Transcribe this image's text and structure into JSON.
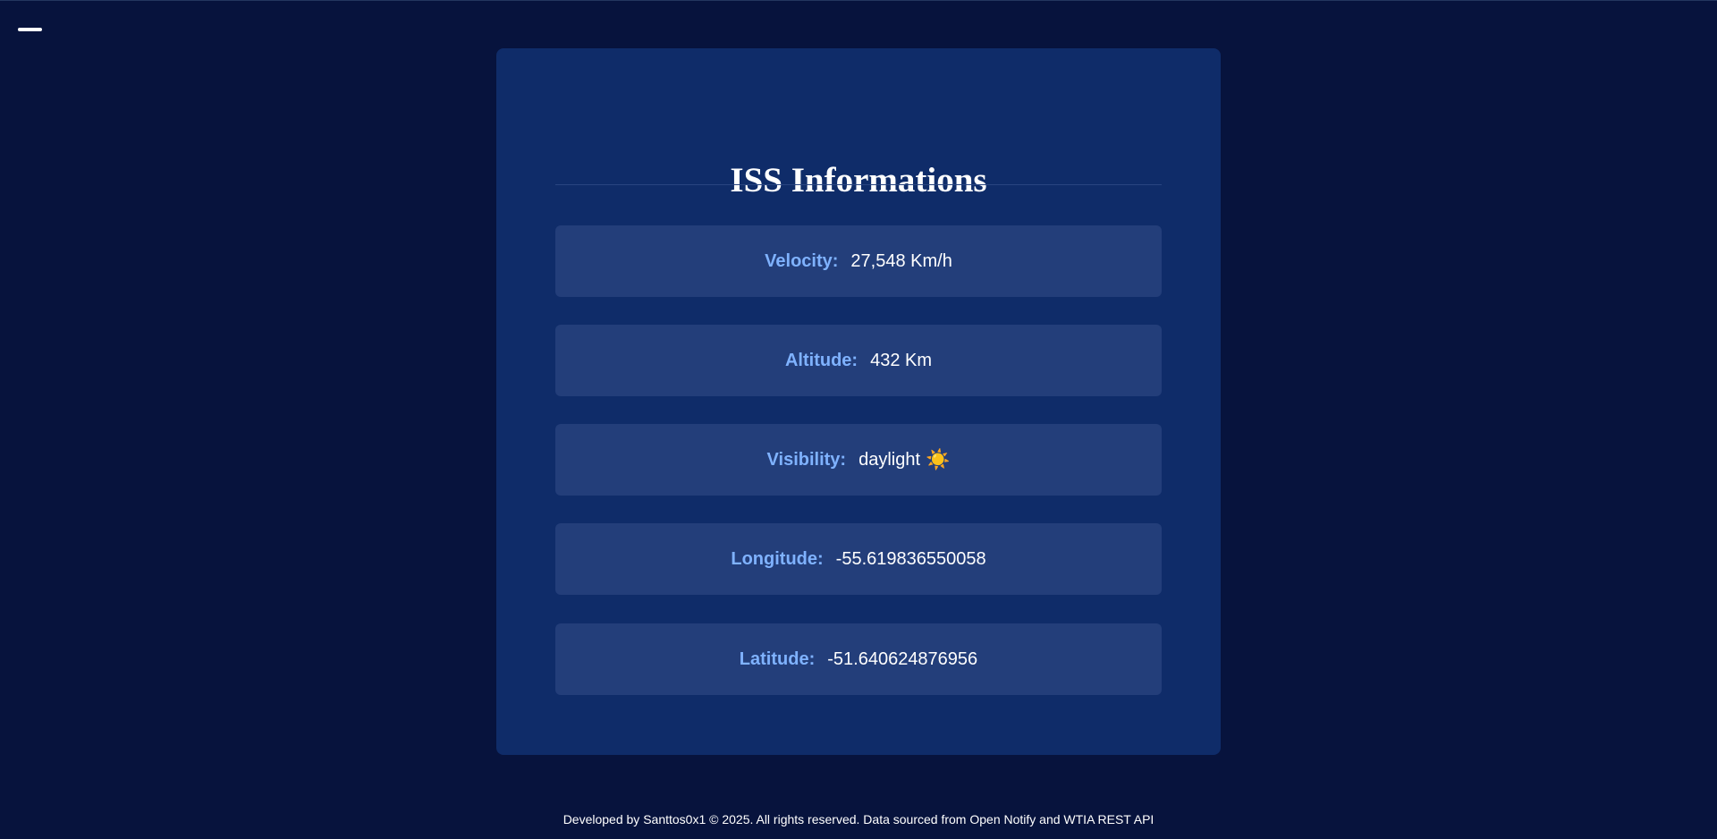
{
  "menu": {
    "icon": "menu-icon"
  },
  "card": {
    "title": "ISS Informations",
    "rows": [
      {
        "label": "Velocity:",
        "value": "27,548 Km/h"
      },
      {
        "label": "Altitude:",
        "value": "432 Km"
      },
      {
        "label": "Visibility:",
        "value": "daylight",
        "icon": "sun-icon",
        "icon_glyph": "☀️"
      },
      {
        "label": "Longitude:",
        "value": "-55.619836550058"
      },
      {
        "label": "Latitude:",
        "value": "-51.640624876956"
      }
    ]
  },
  "footer": {
    "text": "Developed by Santtos0x1 © 2025. All rights reserved. Data sourced from Open Notify and WTIA REST API"
  },
  "colors": {
    "background": "#07133d",
    "card": "#0f2c69",
    "row": "#233e7a",
    "label": "#7fb2ff",
    "text": "#ffffff"
  }
}
